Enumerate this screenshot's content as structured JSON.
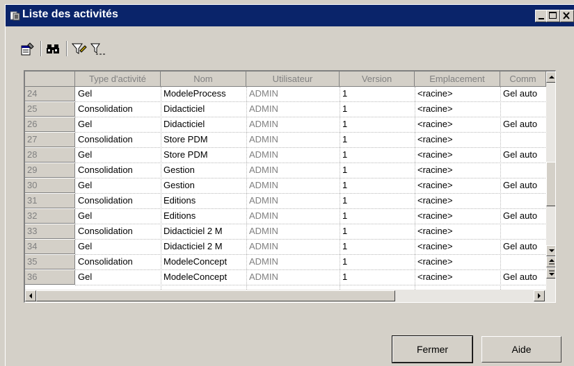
{
  "window": {
    "title": "Liste des activités",
    "controls": [
      "minimize",
      "maximize",
      "close"
    ]
  },
  "toolbar": {
    "buttons": [
      {
        "icon": "properties-icon"
      },
      {
        "icon": "find-binoculars-icon"
      },
      {
        "icon": "filter-icon"
      },
      {
        "icon": "clear-filter-icon"
      }
    ]
  },
  "grid": {
    "columns": [
      "Type d'activité",
      "Nom",
      "Utilisateur",
      "Version",
      "Emplacement",
      "Comm"
    ],
    "rows": [
      {
        "num": "24",
        "type": "Gel",
        "nom": "ModeleProcess",
        "user": "ADMIN",
        "version": "1",
        "emplacement": "<racine>",
        "comm": "Gel auto"
      },
      {
        "num": "25",
        "type": "Consolidation",
        "nom": "Didacticiel",
        "user": "ADMIN",
        "version": "1",
        "emplacement": "<racine>",
        "comm": ""
      },
      {
        "num": "26",
        "type": "Gel",
        "nom": "Didacticiel",
        "user": "ADMIN",
        "version": "1",
        "emplacement": "<racine>",
        "comm": "Gel auto"
      },
      {
        "num": "27",
        "type": "Consolidation",
        "nom": "Store PDM",
        "user": "ADMIN",
        "version": "1",
        "emplacement": "<racine>",
        "comm": ""
      },
      {
        "num": "28",
        "type": "Gel",
        "nom": "Store PDM",
        "user": "ADMIN",
        "version": "1",
        "emplacement": "<racine>",
        "comm": "Gel auto"
      },
      {
        "num": "29",
        "type": "Consolidation",
        "nom": "Gestion",
        "user": "ADMIN",
        "version": "1",
        "emplacement": "<racine>",
        "comm": ""
      },
      {
        "num": "30",
        "type": "Gel",
        "nom": "Gestion",
        "user": "ADMIN",
        "version": "1",
        "emplacement": "<racine>",
        "comm": "Gel auto"
      },
      {
        "num": "31",
        "type": "Consolidation",
        "nom": "Editions",
        "user": "ADMIN",
        "version": "1",
        "emplacement": "<racine>",
        "comm": ""
      },
      {
        "num": "32",
        "type": "Gel",
        "nom": "Editions",
        "user": "ADMIN",
        "version": "1",
        "emplacement": "<racine>",
        "comm": "Gel auto"
      },
      {
        "num": "33",
        "type": "Consolidation",
        "nom": "Didacticiel 2 M",
        "user": "ADMIN",
        "version": "1",
        "emplacement": "<racine>",
        "comm": ""
      },
      {
        "num": "34",
        "type": "Gel",
        "nom": "Didacticiel 2 M",
        "user": "ADMIN",
        "version": "1",
        "emplacement": "<racine>",
        "comm": "Gel auto"
      },
      {
        "num": "35",
        "type": "Consolidation",
        "nom": "ModeleConcept",
        "user": "ADMIN",
        "version": "1",
        "emplacement": "<racine>",
        "comm": ""
      },
      {
        "num": "36",
        "type": "Gel",
        "nom": "ModeleConcept",
        "user": "ADMIN",
        "version": "1",
        "emplacement": "<racine>",
        "comm": "Gel auto"
      }
    ]
  },
  "buttons": {
    "close_label": "Fermer",
    "help_label": "Aide"
  },
  "colors": {
    "titlebar": "#0a246a",
    "face": "#d4d0c8",
    "disabled_text": "#808080"
  }
}
